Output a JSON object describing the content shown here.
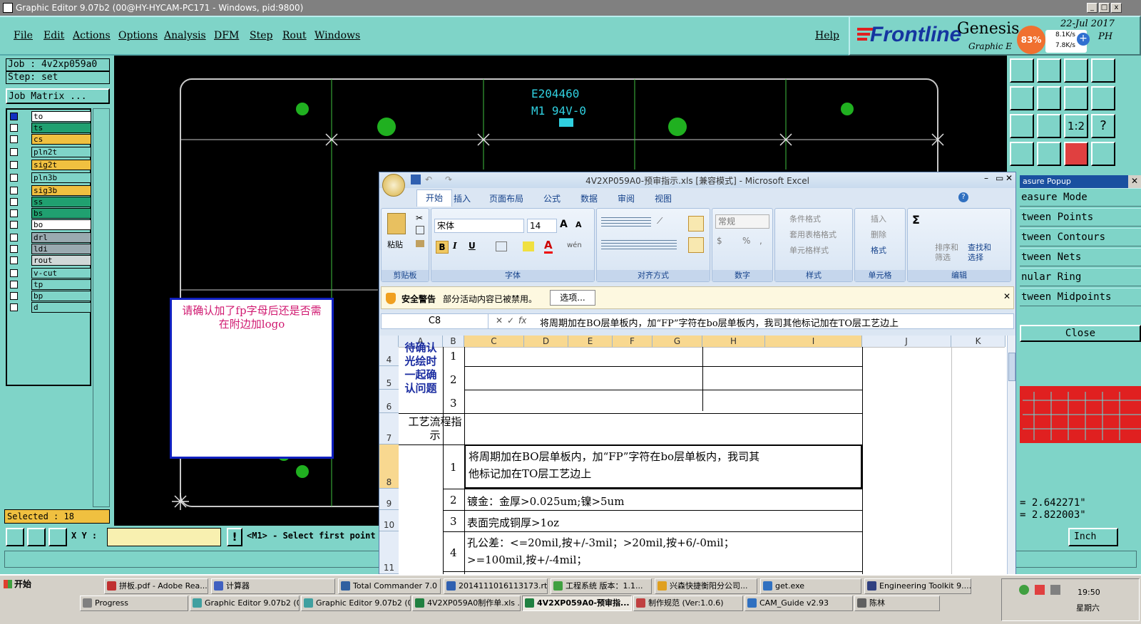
{
  "window": {
    "title": "Graphic Editor 9.07b2 (00@HY-HYCAM-PC171 - Windows, pid:9800)"
  },
  "menu": {
    "items": [
      "File",
      "Edit",
      "Actions",
      "Options",
      "Analysis",
      "DFM",
      "Step",
      "Rout",
      "Windows"
    ],
    "help": "Help"
  },
  "brand": {
    "logo": "Frontline",
    "product": "Genesis",
    "subtitle": "Graphic E",
    "date": "22-Jul 2017",
    "day_suffix": "PH"
  },
  "netmon": {
    "percent": "83%",
    "up": "8.1K/s",
    "down": "7.8K/s"
  },
  "job": {
    "job_label": "Job : 4v2xp059a0",
    "step_label": "Step: set",
    "matrix_button": "Job Matrix ..."
  },
  "layers": [
    {
      "name": "to",
      "color": "#ffffff"
    },
    {
      "name": "ts",
      "color": "#20a070"
    },
    {
      "name": "cs",
      "color": "#f0c040"
    },
    {
      "name": "pln2t",
      "color": "#7fd4c8"
    },
    {
      "name": "sig2t",
      "color": "#f0c040"
    },
    {
      "name": "pln3b",
      "color": "#7fd4c8"
    },
    {
      "name": "sig3b",
      "color": "#f0c040"
    },
    {
      "name": "ss",
      "color": "#20a070"
    },
    {
      "name": "bs",
      "color": "#20a070"
    },
    {
      "name": "bo",
      "color": "#ffffff"
    },
    {
      "name": "drl",
      "color": "#9aaab0"
    },
    {
      "name": "ldi",
      "color": "#9aaab0"
    },
    {
      "name": "rout",
      "color": "#d0d8d8"
    },
    {
      "name": "v-cut",
      "color": "#7fd4c8"
    },
    {
      "name": "tp",
      "color": "#7fd4c8"
    },
    {
      "name": "bp",
      "color": "#7fd4c8"
    },
    {
      "name": "d",
      "color": "#7fd4c8"
    }
  ],
  "selected": "Selected : 18",
  "canvas": {
    "ul_line1": "E204460",
    "ul_line2": "M1 94V-0"
  },
  "note": {
    "text": "请确认加了fp字母后还是否需在附边加logo"
  },
  "measure": {
    "popup_title": "asure Popup",
    "items": [
      "easure Mode",
      "tween Points",
      "tween Contours",
      "tween Nets",
      "nular Ring",
      "tween Midpoints"
    ],
    "close": "Close",
    "val1": "= 2.642271\"",
    "val2": "= 2.822003\"",
    "unit": "Inch"
  },
  "status": {
    "xy_label": "X Y :",
    "message": "<M1> - Select first point"
  },
  "excel": {
    "title": "4V2XP059A0-预审指示.xls [兼容模式] - Microsoft Excel",
    "tabs": [
      "开始",
      "插入",
      "页面布局",
      "公式",
      "数据",
      "审阅",
      "视图"
    ],
    "groups": [
      "剪贴板",
      "字体",
      "对齐方式",
      "数字",
      "样式",
      "单元格",
      "编辑"
    ],
    "font_name": "宋体",
    "font_size": "14",
    "paste": "粘贴",
    "number_format": "常规",
    "style_items": [
      "条件格式",
      "套用表格格式",
      "单元格样式"
    ],
    "cell_items": [
      "插入",
      "删除",
      "格式"
    ],
    "edit_items": [
      "排序和筛选",
      "查找和选择"
    ],
    "security_title": "安全警告",
    "security_msg": "部分活动内容已被禁用。",
    "security_btn": "选项...",
    "cell_ref": "C8",
    "formula": "将周期加在BO层单板内，加“FP”字符在bo层单板内，我司其他标记加在TO层工艺边上",
    "columns": [
      "A",
      "B",
      "C",
      "D",
      "E",
      "F",
      "G",
      "H",
      "I",
      "J",
      "K"
    ],
    "rows": [
      "4",
      "5",
      "6",
      "7",
      "8",
      "9",
      "10",
      "11"
    ],
    "a_confirm": "待确认光绘时一起确认问题",
    "a_process": "工艺流程指示",
    "nums": [
      "1",
      "2",
      "3",
      "1",
      "2",
      "3",
      "4"
    ],
    "c8_line1": "将周期加在BO层单板内，加“FP”字符在bo层单板内，我司其",
    "c8_line2": "他标记加在TO层工艺边上",
    "c9": "镀金：金厚>0.025um;镍>5um",
    "c10": "表面完成铜厚>1oz",
    "c11_line1": "孔公差：<=20mil,按+/-3mil；>20mil,按+6/-0mil；",
    "c11_line2": ">=100mil,按+/-4mil；"
  },
  "taskbar": {
    "start": "开始",
    "row1": [
      "拼板.pdf - Adobe Rea...",
      "计算器",
      "Total Commander 7.0 ...",
      "20141110161131​73.rt...",
      "工程系统 版本：1.1...",
      "兴森快捷衡阳分公司...",
      "get.exe",
      "Engineering Toolkit 9...."
    ],
    "row2": [
      "Progress",
      "Graphic Editor 9.07b2 (0...",
      "Graphic Editor 9.07b2 (0...",
      "4V2XP059A0制作单.xls ...",
      "4V2XP059A0-预审指...",
      "制作规范 (Ver:1.0.6)",
      "CAM_Guide v2.93",
      "陈林"
    ],
    "time": "19:50",
    "weekday": "星期六"
  }
}
